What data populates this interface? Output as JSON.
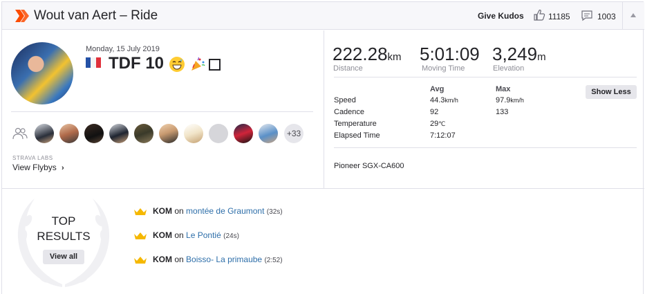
{
  "header": {
    "title": "Wout van Aert – Ride",
    "give_kudos": "Give Kudos",
    "kudos_count": "11185",
    "comment_count": "1003"
  },
  "activity": {
    "date": "Monday, 15 July 2019",
    "name": "TDF 10",
    "flybys_label": "STRAVA LABS",
    "flybys_link": "View Flybys",
    "more_athletes": "+33"
  },
  "stats": {
    "distance": {
      "value": "222.28",
      "unit": "km",
      "label": "Distance"
    },
    "moving_time": {
      "value": "5:01:09",
      "label": "Moving Time"
    },
    "elevation": {
      "value": "3,249",
      "unit": "m",
      "label": "Elevation"
    }
  },
  "details": {
    "col_avg": "Avg",
    "col_max": "Max",
    "show_less": "Show Less",
    "rows": [
      {
        "label": "Speed",
        "avg": "44.3",
        "avg_unit": "km/h",
        "max": "97.9",
        "max_unit": "km/h"
      },
      {
        "label": "Cadence",
        "avg": "92",
        "max": "133"
      },
      {
        "label": "Temperature",
        "avg": "29",
        "avg_unit": "℃"
      },
      {
        "label": "Elapsed Time",
        "avg": "7:12:07"
      }
    ],
    "device": "Pioneer SGX-CA600"
  },
  "results": {
    "title_line1": "TOP",
    "title_line2": "RESULTS",
    "view_all": "View all",
    "items": [
      {
        "badge": "KOM",
        "on": "on",
        "segment": "montée de Graumont",
        "time": "(32s)"
      },
      {
        "badge": "KOM",
        "on": "on",
        "segment": "Le Pontié",
        "time": "(24s)"
      },
      {
        "badge": "KOM",
        "on": "on",
        "segment": "Boisso- La primaube",
        "time": "(2:52)"
      }
    ]
  },
  "colors": {
    "brand_orange": "#fc4c02",
    "link_blue": "#2d6ea9",
    "crown_gold": "#f5b800"
  }
}
